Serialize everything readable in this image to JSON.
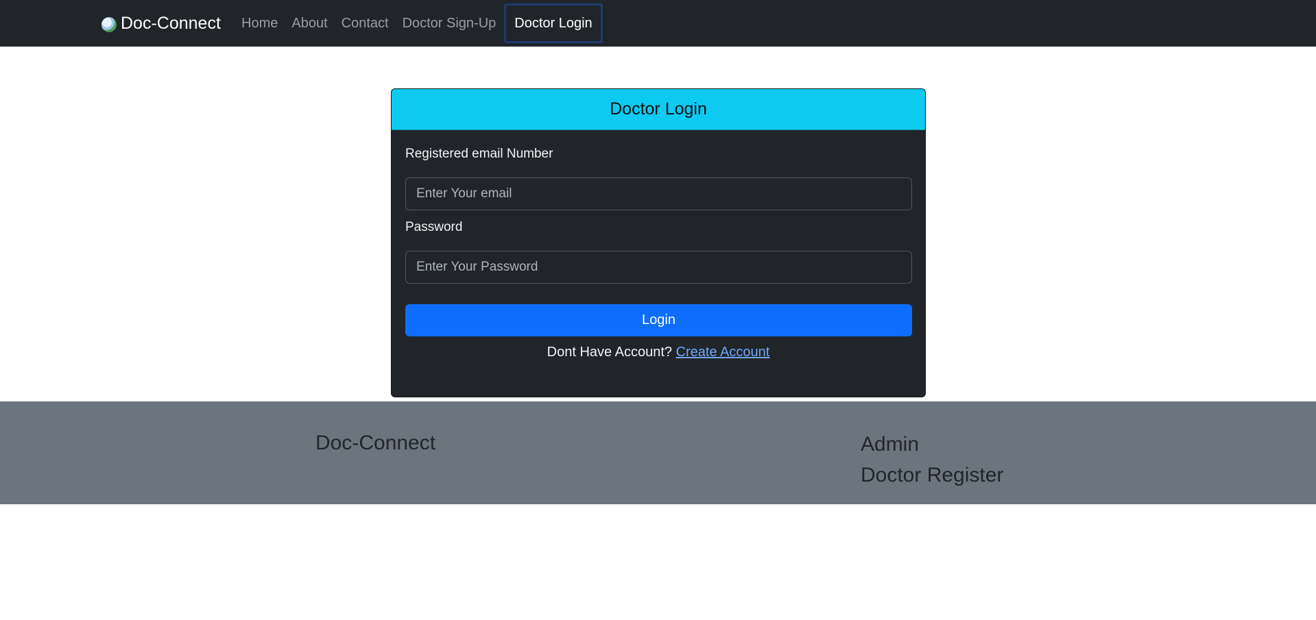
{
  "navbar": {
    "brand": "Doc-Connect",
    "brand_icon": "globe-logo-icon",
    "links": [
      {
        "label": "Home",
        "active": false
      },
      {
        "label": "About",
        "active": false
      },
      {
        "label": "Contact",
        "active": false
      },
      {
        "label": "Doctor Sign-Up",
        "active": false
      },
      {
        "label": "Doctor Login",
        "active": true
      }
    ]
  },
  "login_card": {
    "title": "Doctor Login",
    "email_label": "Registered email Number",
    "email_value": "",
    "email_placeholder": "Enter Your email",
    "password_label": "Password",
    "password_value": "",
    "password_placeholder": "Enter Your Password",
    "submit_label": "Login",
    "account_prompt": "Dont Have Account?",
    "create_account_link": "Create Account"
  },
  "footer": {
    "brand": "Doc-Connect",
    "links": [
      "Admin",
      "Doctor Register"
    ]
  },
  "colors": {
    "navbar_bg": "#212529",
    "card_header_bg": "#0dcaf0",
    "card_bg": "#212529",
    "button_bg": "#0d6efd",
    "link_color": "#6ea8fe",
    "footer_bg": "#6c757d"
  }
}
